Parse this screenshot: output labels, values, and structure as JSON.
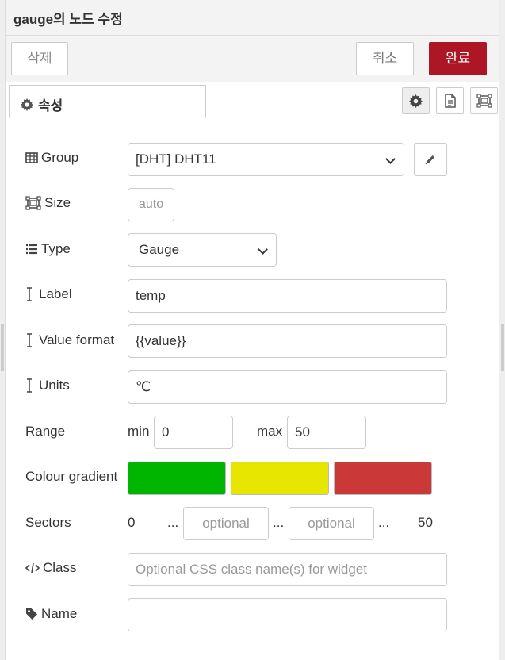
{
  "header": {
    "title": "gauge의 노드 수정"
  },
  "toolbar": {
    "delete_label": "삭제",
    "cancel_label": "취소",
    "done_label": "완료"
  },
  "tabs": {
    "properties_label": "속성"
  },
  "form": {
    "group": {
      "label": "Group",
      "value": "[DHT] DHT11"
    },
    "size": {
      "label": "Size",
      "value": "auto"
    },
    "type": {
      "label": "Type",
      "value": "Gauge"
    },
    "label": {
      "label": "Label",
      "value": "temp"
    },
    "value_format": {
      "label": "Value format",
      "value": "{{value}}"
    },
    "units": {
      "label": "Units",
      "value": "℃"
    },
    "range": {
      "label": "Range",
      "min_label": "min",
      "min_value": "0",
      "max_label": "max",
      "max_value": "50"
    },
    "colour_gradient": {
      "label": "Colour gradient",
      "colors": [
        "#00b500",
        "#e6e600",
        "#ca3838"
      ]
    },
    "sectors": {
      "label": "Sectors",
      "start": "0",
      "sep": "...",
      "placeholder_1": "optional",
      "placeholder_2": "optional",
      "end": "50"
    },
    "class": {
      "label": "Class",
      "placeholder": "Optional CSS class name(s) for widget"
    },
    "name": {
      "label": "Name",
      "value": ""
    }
  },
  "icons": {
    "group": "table-icon",
    "size": "resize-icon",
    "type": "list-icon",
    "text": "text-cursor-icon",
    "class": "code-icon",
    "name": "tag-icon",
    "properties_tab": "gear-icon",
    "edit": "pencil-icon"
  },
  "colors": {
    "accent": "#ad1625",
    "chrome": "#f3f3f3"
  }
}
